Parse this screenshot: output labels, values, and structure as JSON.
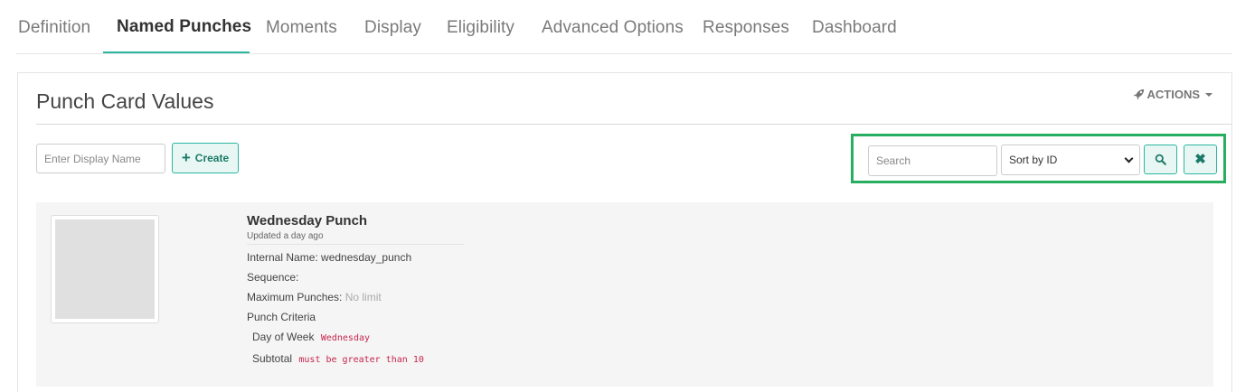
{
  "tabs": [
    {
      "label": "Definition"
    },
    {
      "label": "Named Punches"
    },
    {
      "label": "Moments"
    },
    {
      "label": "Display"
    },
    {
      "label": "Eligibility"
    },
    {
      "label": "Advanced Options"
    },
    {
      "label": "Responses"
    },
    {
      "label": "Dashboard"
    }
  ],
  "active_tab": "Named Punches",
  "card": {
    "title": "Punch Card Values",
    "actions_label": "ACTIONS"
  },
  "create": {
    "placeholder": "Enter Display Name",
    "button_label": "Create"
  },
  "search": {
    "placeholder": "Search",
    "sort_selected": "Sort by ID"
  },
  "punch": {
    "name": "Wednesday Punch",
    "updated": "Updated a day ago",
    "internal_name_label": "Internal Name:",
    "internal_name_value": "wednesday_punch",
    "sequence_label": "Sequence:",
    "max_punches_label": "Maximum Punches:",
    "max_punches_value": "No limit",
    "criteria_label": "Punch Criteria",
    "criteria": [
      {
        "label": "Day of Week",
        "value": "Wednesday"
      },
      {
        "label": "Subtotal",
        "value": "must be greater than 10"
      }
    ]
  },
  "colors": {
    "accent": "#2bb6a0",
    "highlight_box": "#27ae60",
    "code_text": "#c7254e"
  },
  "icons": {
    "actions": "rocket-icon",
    "create": "plus-icon",
    "search": "search-icon",
    "clear": "close-icon"
  }
}
